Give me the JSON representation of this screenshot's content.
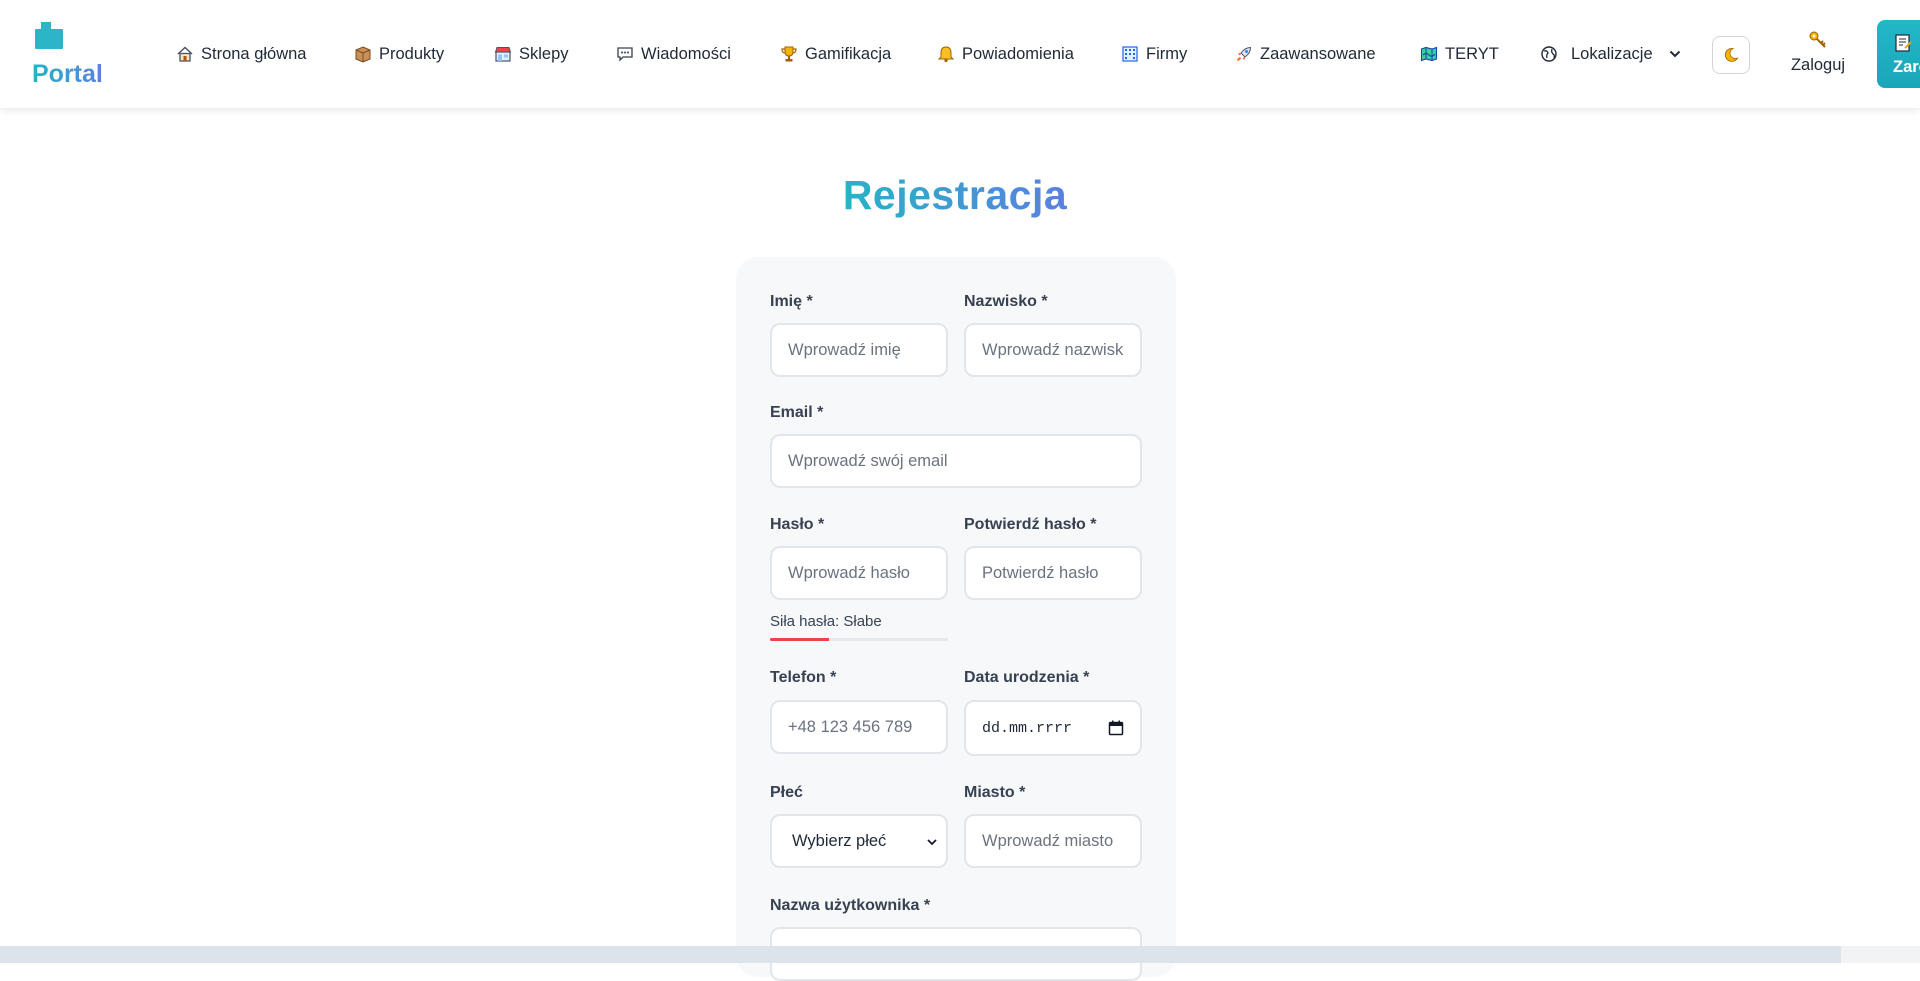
{
  "brand": {
    "name": "Portal",
    "accent": "#2bb5c6",
    "accent_end": "#5b7fe0"
  },
  "nav": {
    "items": [
      {
        "label": "Strona główna",
        "icon": "house-icon"
      },
      {
        "label": "Produkty",
        "icon": "box-icon"
      },
      {
        "label": "Sklepy",
        "icon": "store-icon"
      },
      {
        "label": "Wiadomości",
        "icon": "chat-bubble-icon"
      },
      {
        "label": "Gamifikacja",
        "icon": "trophy-icon"
      },
      {
        "label": "Powiadomienia",
        "icon": "bell-icon"
      },
      {
        "label": "Firmy",
        "icon": "building-icon"
      },
      {
        "label": "Zaawansowane",
        "icon": "rocket-icon"
      },
      {
        "label": "TERYT",
        "icon": "map-book-icon"
      },
      {
        "label": "Lokalizacje",
        "icon": "globe-icon"
      }
    ],
    "theme_toggle_icon": "moon-icon",
    "login_label": "Zaloguj",
    "login_icon": "key-icon",
    "register_label": "Zarejestruj",
    "register_icon": "memo-icon"
  },
  "page": {
    "title": "Rejestracja"
  },
  "form": {
    "first_name": {
      "label": "Imię *",
      "placeholder": "Wprowadź imię",
      "value": ""
    },
    "last_name": {
      "label": "Nazwisko *",
      "placeholder": "Wprowadź nazwisko",
      "value": ""
    },
    "email": {
      "label": "Email *",
      "placeholder": "Wprowadź swój email",
      "value": ""
    },
    "password": {
      "label": "Hasło *",
      "placeholder": "Wprowadź hasło",
      "value": ""
    },
    "confirm_password": {
      "label": "Potwierdź hasło *",
      "placeholder": "Potwierdź hasło",
      "value": ""
    },
    "password_strength": {
      "label": "Siła hasła: Słabe",
      "level": 0.33,
      "color": "#ef4444"
    },
    "phone": {
      "label": "Telefon *",
      "placeholder": "+48 123 456 789",
      "value": ""
    },
    "birth_date": {
      "label": "Data urodzenia *",
      "placeholder": "dd.mm.rrrr"
    },
    "gender": {
      "label": "Płeć",
      "selected": "Wybierz płeć"
    },
    "city": {
      "label": "Miasto *",
      "placeholder": "Wprowadź miasto",
      "value": ""
    },
    "username": {
      "label": "Nazwa użytkownika *",
      "placeholder": "",
      "value": ""
    }
  }
}
